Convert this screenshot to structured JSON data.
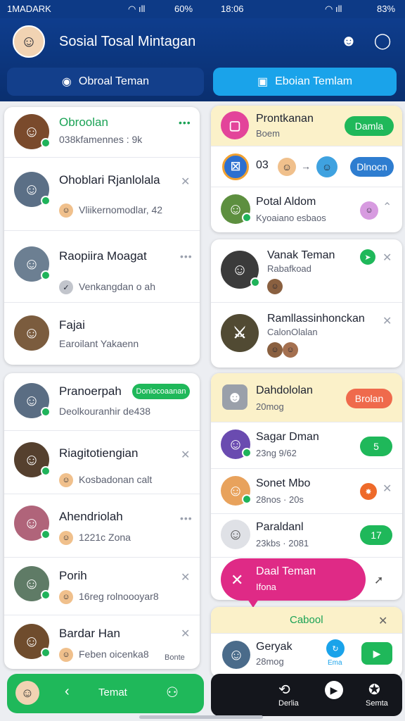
{
  "status": {
    "left_time": "1MADARK",
    "left_battery": "60%",
    "right_time": "18:06",
    "right_battery": "83%"
  },
  "header": {
    "title": "Sosial Tosal Mintagan",
    "tabs": [
      {
        "label": "Obroal Teman"
      },
      {
        "label": "Eboian Temlam"
      }
    ]
  },
  "left_card1": {
    "items": [
      {
        "name": "Obroolan",
        "sub": "038kfamennes : 9k"
      },
      {
        "name": "Ohoblari Rjanlolala",
        "sub": "Vliikernomodlar, 42"
      },
      {
        "name": "Raopiira Moagat",
        "sub": "Venkangdan o ah"
      },
      {
        "name": "Fajai",
        "sub": "Earoilant Yakaenn"
      }
    ]
  },
  "left_card2": {
    "items": [
      {
        "name": "Pranoerpah",
        "sub": "Deolkouranhir de438",
        "badge": "Doniocoaanan"
      },
      {
        "name": "Riagitotiengian",
        "sub": "Kosbadonan calt"
      },
      {
        "name": "Ahendriolah",
        "sub": "1221c Zona"
      },
      {
        "name": "Porih",
        "sub": "16reg rolnoooyar8"
      },
      {
        "name": "Bardar Han",
        "sub": "Feben oicenka8",
        "extra": "Bonte"
      }
    ]
  },
  "right_card1": {
    "items": [
      {
        "name": "Prontkanan",
        "sub": "Boem",
        "btn": "Damla"
      },
      {
        "name": "03",
        "btn": "Dlnocn"
      },
      {
        "name": "Potal Aldom",
        "sub": "Kyoaiano esbaos"
      }
    ]
  },
  "right_card2": {
    "items": [
      {
        "name": "Vanak Teman",
        "sub": "Rabafkoad"
      },
      {
        "name": "Ramllassinhonckan",
        "sub": "CalonOlalan"
      }
    ]
  },
  "right_card3": {
    "header": {
      "name": "Dahdololan",
      "sub": "20mog",
      "btn": "Brolan"
    },
    "items": [
      {
        "name": "Sagar Dman",
        "sub": "23ng 9/62",
        "btn": "5"
      },
      {
        "name": "Sonet Mbo",
        "sub": "28nos · 20s"
      },
      {
        "name": "Paraldanl",
        "sub": "23kbs · 2081",
        "btn": "17"
      }
    ]
  },
  "toast": {
    "title": "Daal Teman",
    "sub": "Ifona"
  },
  "right_card4": {
    "title": "Cabool",
    "items": [
      {
        "name": "Geryak",
        "sub": "28mog",
        "extra": "Ema"
      }
    ]
  },
  "bottom_left": {
    "label": "Temat"
  },
  "bottom_right": {
    "items": [
      {
        "label": "Derlia"
      },
      {
        "label": ""
      },
      {
        "label": "Semta"
      }
    ]
  },
  "colors": {
    "header": "#0e3d8d",
    "active_tab": "#1aa3ea",
    "green": "#1fb85a",
    "pink": "#df2a86",
    "orange": "#ef6a4c"
  }
}
